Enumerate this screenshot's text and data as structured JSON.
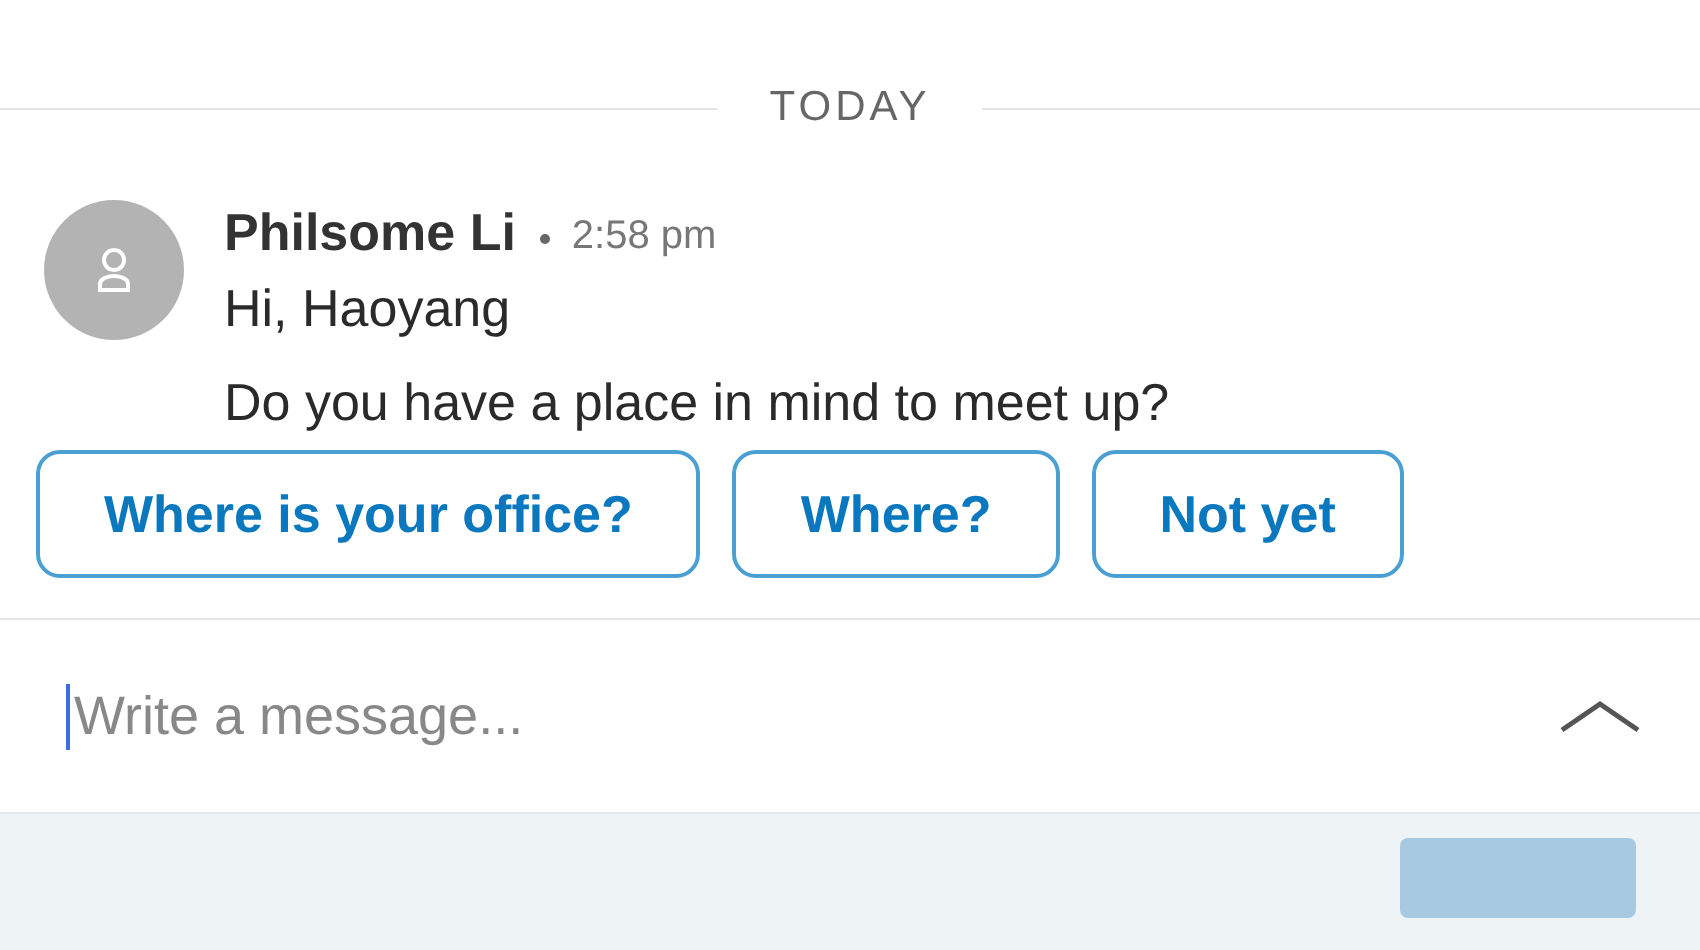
{
  "divider": {
    "label": "TODAY"
  },
  "message": {
    "sender": "Philsome Li",
    "time": "2:58 pm",
    "lines": [
      "Hi, Haoyang",
      "Do you have a place in mind to meet up?"
    ]
  },
  "quick_replies": [
    "Where is your office?",
    "Where?",
    "Not yet"
  ],
  "composer": {
    "placeholder": "Write a message..."
  }
}
